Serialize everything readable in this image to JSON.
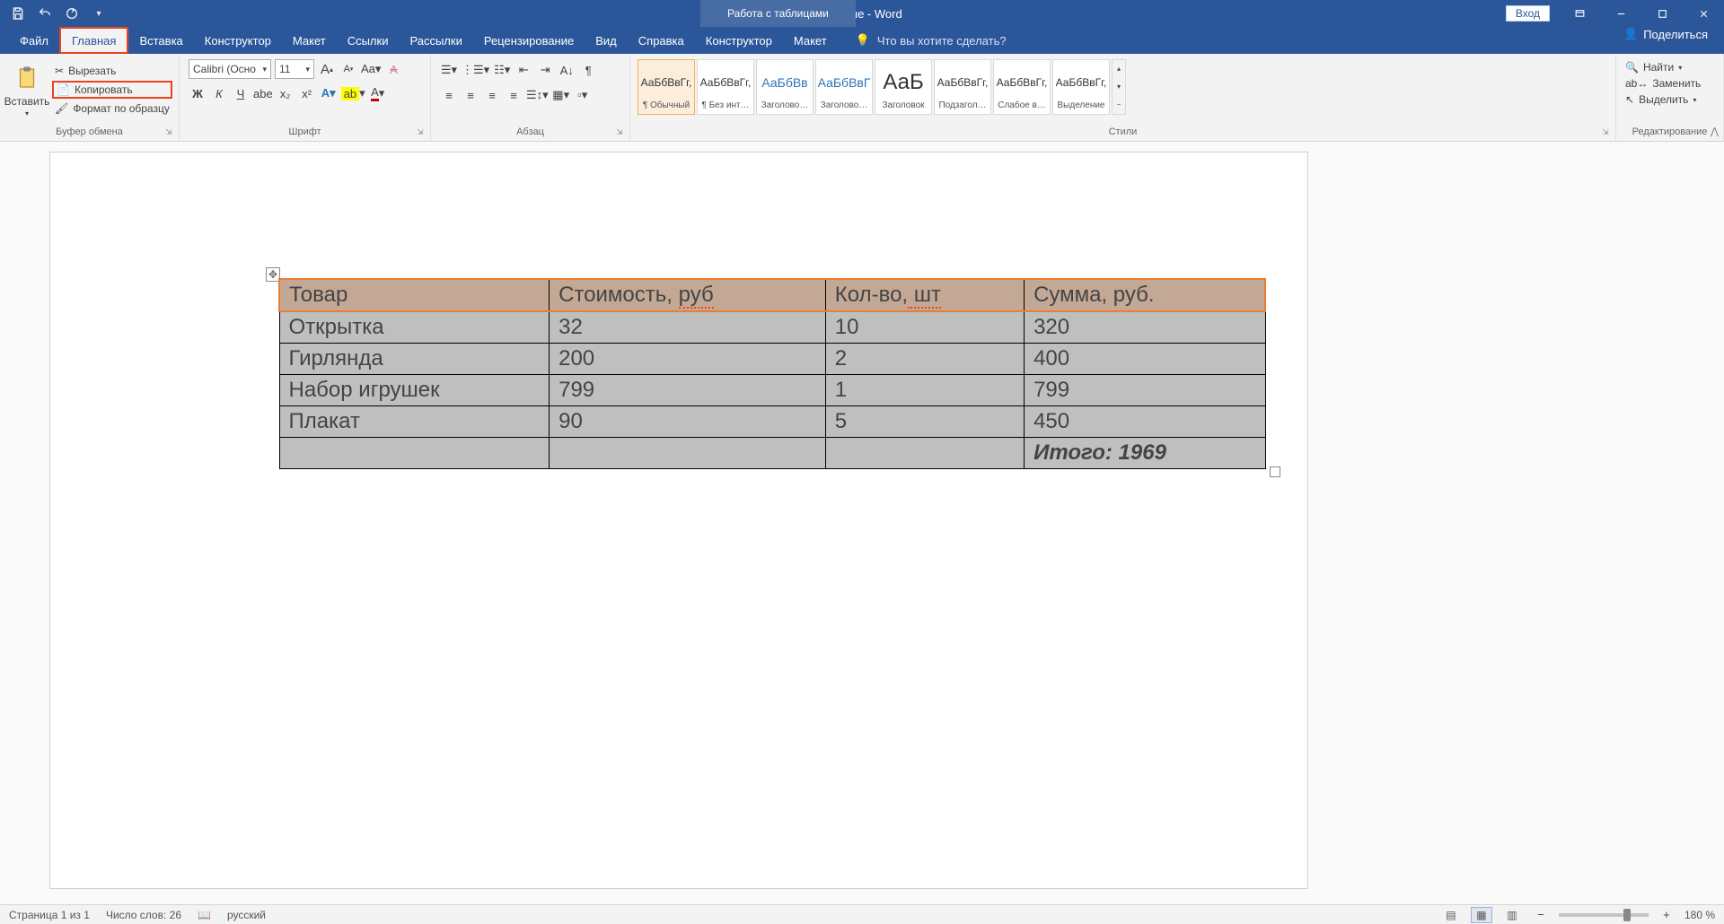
{
  "titlebar": {
    "doc_title": "Данные  -  Word",
    "tab_tools": "Работа с таблицами",
    "login": "Вход"
  },
  "tabs": {
    "file": "Файл",
    "home": "Главная",
    "insert": "Вставка",
    "design": "Конструктор",
    "layout": "Макет",
    "references": "Ссылки",
    "mailings": "Рассылки",
    "review": "Рецензирование",
    "view": "Вид",
    "help": "Справка",
    "t_design": "Конструктор",
    "t_layout": "Макет",
    "tellme": "Что вы хотите сделать?",
    "share": "Поделиться"
  },
  "ribbon": {
    "clipboard": {
      "paste": "Вставить",
      "cut": "Вырезать",
      "copy": "Копировать",
      "format_painter": "Формат по образцу",
      "group": "Буфер обмена"
    },
    "font": {
      "name": "Calibri (Осно",
      "size": "11",
      "group": "Шрифт",
      "bold": "Ж",
      "italic": "К",
      "underline": "Ч"
    },
    "paragraph": {
      "group": "Абзац"
    },
    "styles": {
      "group": "Стили",
      "items": [
        {
          "preview": "АаБбВвГг,",
          "label": "¶ Обычный"
        },
        {
          "preview": "АаБбВвГг,",
          "label": "¶ Без инт…"
        },
        {
          "preview": "АаБбВв",
          "label": "Заголово…",
          "blue": true
        },
        {
          "preview": "АаБбВвГ",
          "label": "Заголово…",
          "blue": true
        },
        {
          "preview": "АаБ",
          "label": "Заголовок",
          "big": true
        },
        {
          "preview": "АаБбВвГг,",
          "label": "Подзагол…"
        },
        {
          "preview": "АаБбВвГг,",
          "label": "Слабое в…"
        },
        {
          "preview": "АаБбВвГг,",
          "label": "Выделение"
        }
      ]
    },
    "editing": {
      "find": "Найти",
      "replace": "Заменить",
      "select": "Выделить",
      "group": "Редактирование"
    }
  },
  "table": {
    "headers": [
      "Товар",
      "Стоимость, руб",
      "Кол-во, шт",
      "Сумма, руб."
    ],
    "rows": [
      [
        "Открытка",
        "32",
        "10",
        "320"
      ],
      [
        "Гирлянда",
        "200",
        "2",
        "400"
      ],
      [
        "Набор игрушек",
        "799",
        "1",
        "799"
      ],
      [
        "Плакат",
        "90",
        "5",
        "450"
      ]
    ],
    "total": "Итого: 1969"
  },
  "statusbar": {
    "page": "Страница 1 из 1",
    "words": "Число слов: 26",
    "lang": "русский",
    "zoom": "180 %"
  }
}
